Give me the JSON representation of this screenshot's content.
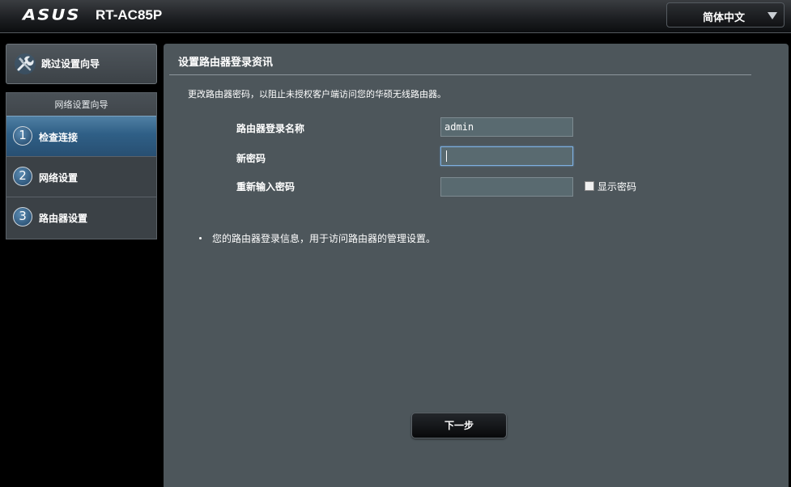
{
  "header": {
    "brand": "ASUS",
    "model": "RT-AC85P",
    "language": "简体中文"
  },
  "sidebar": {
    "skip_wizard_label": "跳过设置向导",
    "wizard_title": "网络设置向导",
    "steps": [
      {
        "num": "1",
        "label": "检查连接",
        "active": true
      },
      {
        "num": "2",
        "label": "网络设置",
        "active": false
      },
      {
        "num": "3",
        "label": "路由器设置",
        "active": false
      }
    ]
  },
  "main": {
    "title": "设置路由器登录资讯",
    "description": "更改路由器密码，以阻止未授权客户端访问您的华硕无线路由器。",
    "form": {
      "username_label": "路由器登录名称",
      "username_value": "admin",
      "new_password_label": "新密码",
      "new_password_value": "",
      "confirm_password_label": "重新输入密码",
      "confirm_password_value": "",
      "show_password_label": "显示密码",
      "show_password_checked": false
    },
    "note": "您的路由器登录信息，用于访问路由器的管理设置。",
    "next_button": "下一步"
  },
  "colors": {
    "panel_bg": "#4d565b",
    "active_step": "#2f5f86",
    "field_bg": "#596a70",
    "focus_border": "#7fb0e0"
  },
  "icons": {
    "skip": "wrench-screwdriver-icon",
    "language_dropdown": "caret-down-icon"
  }
}
